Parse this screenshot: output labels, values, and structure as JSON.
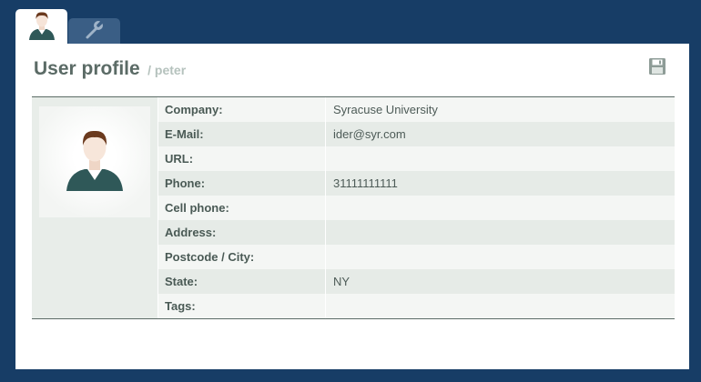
{
  "tabs": [
    {
      "icon": "user-icon",
      "active": true
    },
    {
      "icon": "wrench-icon",
      "active": false
    }
  ],
  "header": {
    "title": "User profile",
    "subtitle": "/ peter",
    "save_icon": "save-icon"
  },
  "profile": {
    "avatar_icon": "user-avatar",
    "fields": [
      {
        "label": "Company:",
        "value": "Syracuse University"
      },
      {
        "label": "E-Mail:",
        "value": "ider@syr.com"
      },
      {
        "label": "URL:",
        "value": ""
      },
      {
        "label": "Phone:",
        "value": "31111111111"
      },
      {
        "label": "Cell phone:",
        "value": ""
      },
      {
        "label": "Address:",
        "value": ""
      },
      {
        "label": "Postcode / City:",
        "value": ""
      },
      {
        "label": "State:",
        "value": "NY"
      },
      {
        "label": "Tags:",
        "value": ""
      }
    ]
  },
  "colors": {
    "background": "#173d66",
    "title": "#5b6b66",
    "row_odd": "#f4f6f4",
    "row_even": "#e6ebe7"
  }
}
